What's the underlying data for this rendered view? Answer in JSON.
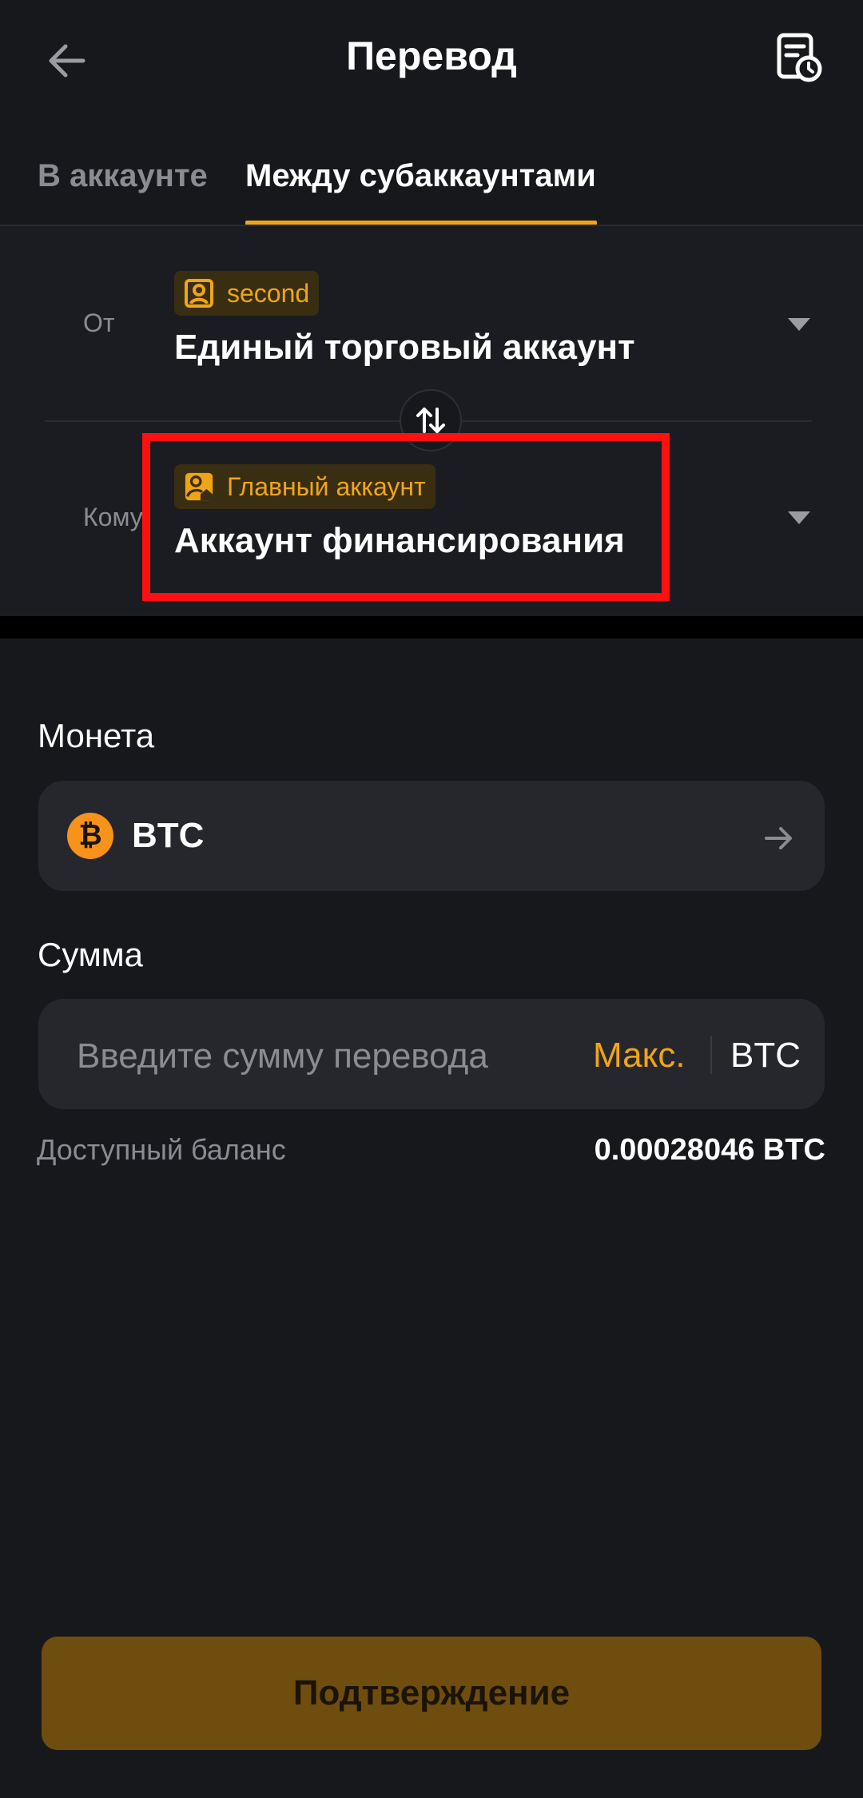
{
  "header": {
    "title": "Перевод",
    "back_icon": "arrow-left-icon",
    "history_icon": "document-clock-icon"
  },
  "tabs": [
    {
      "label": "В аккаунте",
      "active": false
    },
    {
      "label": "Между субаккаунтами",
      "active": true
    }
  ],
  "transfer": {
    "from": {
      "label": "От",
      "badge": "second",
      "badge_icon": "user-icon",
      "account": "Единый торговый аккаунт"
    },
    "to": {
      "label": "Кому",
      "badge": "Главный аккаунт",
      "badge_icon": "user-home-icon",
      "account": "Аккаунт финансирования"
    },
    "swap_icon": "swap-vertical-icon"
  },
  "coin": {
    "label": "Монета",
    "value": "BTC",
    "icon": "bitcoin-icon",
    "symbol": "₿"
  },
  "amount": {
    "label": "Сумма",
    "placeholder": "Введите сумму перевода",
    "max_label": "Макс.",
    "unit": "BTC"
  },
  "balance": {
    "label": "Доступный баланс",
    "value": "0.00028046 BTC"
  },
  "confirm_label": "Подтверждение",
  "colors": {
    "accent": "#f0a516",
    "background": "#17181c",
    "highlight": "#ff1010",
    "confirm_bg": "#6e4d0f"
  }
}
